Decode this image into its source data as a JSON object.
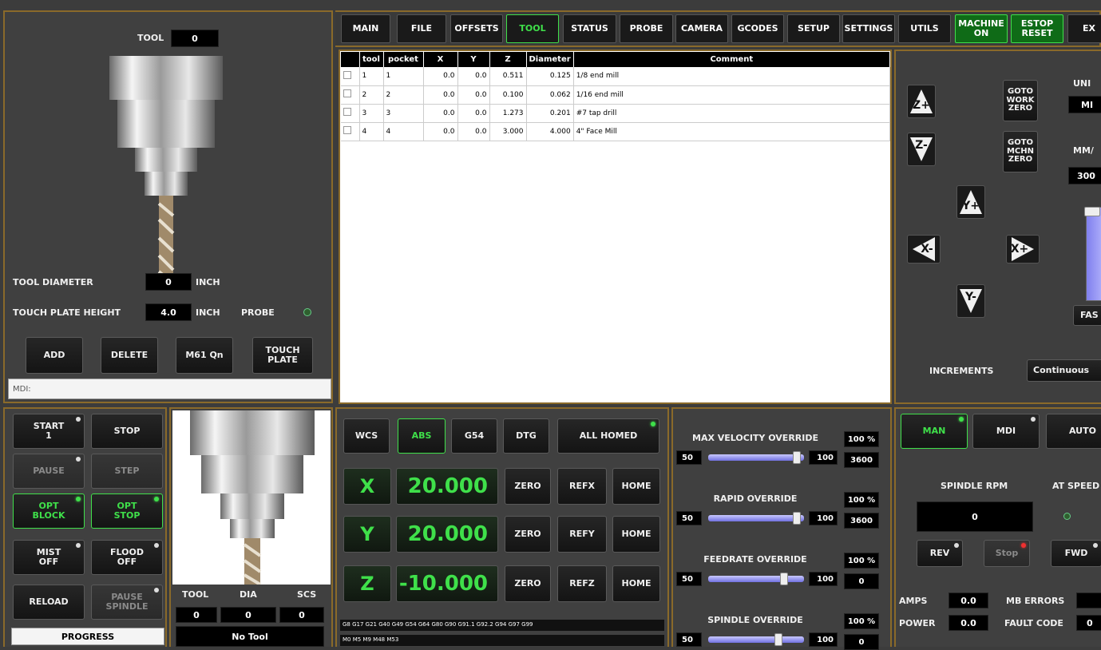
{
  "tabs": [
    {
      "label": "MAIN"
    },
    {
      "label": "FILE"
    },
    {
      "label": "OFFSETS"
    },
    {
      "label": "TOOL",
      "selected": true
    },
    {
      "label": "STATUS"
    },
    {
      "label": "PROBE"
    },
    {
      "label": "CAMERA"
    },
    {
      "label": "GCODES"
    },
    {
      "label": "SETUP"
    },
    {
      "label": "SETTINGS"
    },
    {
      "label": "UTILS"
    },
    {
      "label": "MACHINE ON"
    },
    {
      "label": "ESTOP RESET"
    },
    {
      "label": "EX"
    }
  ],
  "tool_panel": {
    "tool_label": "TOOL",
    "tool_value": "0",
    "diameter_label": "TOOL DIAMETER",
    "diameter_value": "0",
    "diameter_unit": "INCH",
    "plate_label": "TOUCH PLATE HEIGHT",
    "plate_value": "4.0",
    "plate_unit": "INCH",
    "probe_label": "PROBE",
    "buttons": [
      "ADD",
      "DELETE",
      "M61 Qn",
      "TOUCH PLATE"
    ],
    "mdi_label": "MDI:"
  },
  "tool_table": {
    "headers": [
      "",
      "tool",
      "pocket",
      "X",
      "Y",
      "Z",
      "Diameter",
      "Comment"
    ],
    "rows": [
      {
        "tool": "1",
        "pocket": "1",
        "x": "0.0",
        "y": "0.0",
        "z": "0.511",
        "dia": "0.125",
        "comment": "1/8 end mill"
      },
      {
        "tool": "2",
        "pocket": "2",
        "x": "0.0",
        "y": "0.0",
        "z": "0.100",
        "dia": "0.062",
        "comment": "1/16 end mill"
      },
      {
        "tool": "3",
        "pocket": "3",
        "x": "0.0",
        "y": "0.0",
        "z": "1.273",
        "dia": "0.201",
        "comment": "#7 tap drill"
      },
      {
        "tool": "4",
        "pocket": "4",
        "x": "0.0",
        "y": "0.0",
        "z": "3.000",
        "dia": "4.000",
        "comment": "4\" Face Mill"
      }
    ]
  },
  "jog": {
    "goto_work": "GOTO WORK ZERO",
    "goto_mchn": "GOTO MCHN ZERO",
    "units_label": "UNI",
    "units_value": "MI",
    "rate_label": "MM/",
    "rate_value": "300",
    "fast_label": "FAS",
    "increments_label": "INCREMENTS",
    "increments_value": "Continuous",
    "zplus": "Z+",
    "zminus": "Z-",
    "yplus": "Y+",
    "yminus": "Y-",
    "xplus": "X+",
    "xminus": "X-"
  },
  "program": {
    "start": "START 1",
    "stop": "STOP",
    "pause": "PAUSE",
    "step": "STEP",
    "opt_block": "OPT BLOCK",
    "opt_stop": "OPT STOP",
    "mist": "MIST OFF",
    "flood": "FLOOD OFF",
    "reload": "RELOAD",
    "pause_spindle": "PAUSE SPINDLE",
    "progress": "PROGRESS"
  },
  "tool_info": {
    "tool_label": "TOOL",
    "dia_label": "DIA",
    "scs_label": "SCS",
    "tool_value": "0",
    "dia_value": "0",
    "scs_value": "0",
    "no_tool": "No Tool"
  },
  "dro": {
    "wcs": "WCS",
    "abs": "ABS",
    "g54": "G54",
    "dtg": "DTG",
    "all_homed": "ALL HOMED",
    "axes": [
      {
        "name": "X",
        "value": "20.000",
        "ref": "REFX"
      },
      {
        "name": "Y",
        "value": "20.000",
        "ref": "REFY"
      },
      {
        "name": "Z",
        "value": "-10.000",
        "ref": "REFZ"
      }
    ],
    "zero": "ZERO",
    "home": "HOME",
    "gcodes": "G8 G17 G21 G40 G49 G54 G64 G80 G90 G91.1 G92.2 G94 G97 G99",
    "mcodes": "M0 M5 M9 M48 M53"
  },
  "overrides": [
    {
      "label": "MAX VELOCITY OVERRIDE",
      "pct": "100 %",
      "min": "50",
      "max": "100",
      "value": "3600",
      "fraction": 0.96
    },
    {
      "label": "RAPID OVERRIDE",
      "pct": "100 %",
      "min": "50",
      "max": "100",
      "value": "3600",
      "fraction": 0.96
    },
    {
      "label": "FEEDRATE OVERRIDE",
      "pct": "100 %",
      "min": "50",
      "max": "100",
      "value": "0",
      "fraction": 0.82
    },
    {
      "label": "SPINDLE OVERRIDE",
      "pct": "100 %",
      "min": "50",
      "max": "100",
      "value": "0",
      "fraction": 0.75
    }
  ],
  "spindle": {
    "man": "MAN",
    "mdi": "MDI",
    "auto": "AUTO",
    "rpm_label": "SPINDLE RPM",
    "at_speed": "AT SPEED",
    "rpm_value": "0",
    "rev": "REV",
    "stop": "Stop",
    "fwd": "FWD",
    "amps_label": "AMPS",
    "amps_value": "0.0",
    "mb_label": "MB ERRORS",
    "power_label": "POWER",
    "power_value": "0.0",
    "fault_label": "FAULT CODE",
    "fault_value": "0"
  }
}
